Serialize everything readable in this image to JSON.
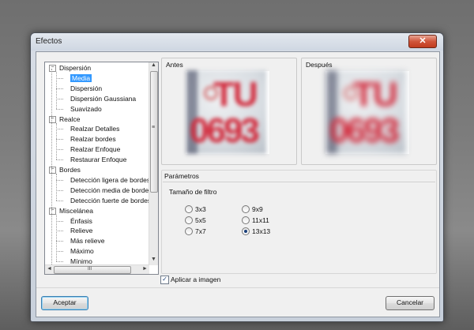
{
  "window": {
    "title": "Efectos",
    "close_glyph": "✕"
  },
  "tree": {
    "items": [
      {
        "label": "Dispersión",
        "level": 0,
        "expander": "−"
      },
      {
        "label": "Media",
        "level": 1,
        "selected": true
      },
      {
        "label": "Dispersión",
        "level": 1
      },
      {
        "label": "Dispersión Gaussiana",
        "level": 1
      },
      {
        "label": "Suavizado",
        "level": 1
      },
      {
        "label": "Realce",
        "level": 0,
        "expander": "−"
      },
      {
        "label": "Realzar Detalles",
        "level": 1
      },
      {
        "label": "Realzar bordes",
        "level": 1
      },
      {
        "label": "Realzar Enfoque",
        "level": 1
      },
      {
        "label": "Restaurar Enfoque",
        "level": 1
      },
      {
        "label": "Bordes",
        "level": 0,
        "expander": "−"
      },
      {
        "label": "Detección ligera de bordes",
        "level": 1
      },
      {
        "label": "Detección media de bordes",
        "level": 1
      },
      {
        "label": "Detección fuerte de bordes",
        "level": 1
      },
      {
        "label": "Miscelánea",
        "level": 0,
        "expander": "−"
      },
      {
        "label": "Énfasis",
        "level": 1
      },
      {
        "label": "Relieve",
        "level": 1
      },
      {
        "label": "Más relieve",
        "level": 1
      },
      {
        "label": "Máximo",
        "level": 1
      },
      {
        "label": "Mínimo",
        "level": 1
      }
    ],
    "scroll_up": "▲",
    "scroll_down": "▼",
    "scroll_left": "◄",
    "scroll_right": "►",
    "grip": "≡",
    "hgrip": "III"
  },
  "before": {
    "label": "Antes",
    "plate_text_top": "TU",
    "plate_text_bottom": "0693"
  },
  "after": {
    "label": "Después",
    "plate_text_top": "TU",
    "plate_text_bottom": "0693"
  },
  "params": {
    "label": "Parámetros",
    "filter_size_label": "Tamaño de filtro",
    "options": [
      {
        "label": "3x3",
        "checked": false
      },
      {
        "label": "5x5",
        "checked": false
      },
      {
        "label": "7x7",
        "checked": false
      },
      {
        "label": "9x9",
        "checked": false
      },
      {
        "label": "11x11",
        "checked": false
      },
      {
        "label": "13x13",
        "checked": true
      }
    ]
  },
  "apply": {
    "label": "Aplicar a imagen",
    "checked": true,
    "mark": "✓"
  },
  "buttons": {
    "accept": "Aceptar",
    "cancel": "Cancelar"
  },
  "colors": {
    "selection": "#3399ff",
    "plate_text": "#d2283a"
  }
}
